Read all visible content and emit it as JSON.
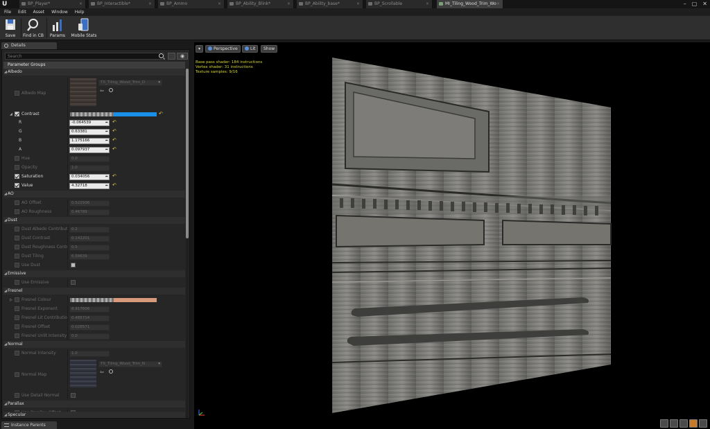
{
  "tabs": [
    {
      "label": "BP_Player*",
      "active": false
    },
    {
      "label": "BP_Interactible*",
      "active": false
    },
    {
      "label": "BP_Ammo",
      "active": false
    },
    {
      "label": "BP_Ability_Blink*",
      "active": false
    },
    {
      "label": "BP_Ability_base*",
      "active": false
    },
    {
      "label": "BP_Scrollable",
      "active": false
    },
    {
      "label": "MI_Tiling_Wood_Trim_Wo",
      "active": true
    }
  ],
  "menu": [
    "File",
    "Edit",
    "Asset",
    "Window",
    "Help"
  ],
  "toolbar": {
    "save": "Save",
    "find_in_cb": "Find in CB",
    "params": "Params",
    "mobile_stats": "Mobile Stats"
  },
  "details": {
    "tab_label": "Details",
    "search_placeholder": "Search",
    "param_groups": "Parameter Groups",
    "instance_parents": "Instance Parents"
  },
  "albedo": {
    "category": "Albedo",
    "albedo_map": {
      "label": "Albedo Map",
      "texture": "TX_Tiling_Wood_Trim_D"
    },
    "contrast": {
      "label": "Contrast",
      "bar_color": "#1a8fe8"
    },
    "r": {
      "label": "R",
      "value": "-0.064539"
    },
    "g": {
      "label": "G",
      "value": "0.63381"
    },
    "b": {
      "label": "B",
      "value": "1.175166"
    },
    "a": {
      "label": "A",
      "value": "0.097937"
    },
    "hue": {
      "label": "Hue",
      "value": "0.0"
    },
    "opacity": {
      "label": "Opacity",
      "value": "1.0"
    },
    "saturation": {
      "label": "Saturation",
      "value": "0.034056"
    },
    "value": {
      "label": "Value",
      "value": "4.32718"
    }
  },
  "ao": {
    "category": "AO",
    "ao_offset": {
      "label": "AO Offset",
      "value": "0.522936"
    },
    "ao_roughness": {
      "label": "AO Roughness",
      "value": "0.46789"
    }
  },
  "dust": {
    "category": "Dust",
    "albedo_contribution": {
      "label": "Dust Albedo Contribution",
      "value": "0.2"
    },
    "contrast": {
      "label": "Dust Contrast",
      "value": "0.142201"
    },
    "roughness_contribution": {
      "label": "Dust Roughness Contribution",
      "value": "0.5"
    },
    "tiling": {
      "label": "Dust Tiling",
      "value": "6.59639"
    },
    "use_dust": {
      "label": "Use Dust"
    }
  },
  "emissive": {
    "category": "Emissive",
    "use_emissive": {
      "label": "Use Emissive"
    }
  },
  "fresnel": {
    "category": "Fresnel",
    "colour": {
      "label": "Fresnel Colour",
      "bar_color": "#d89a7a"
    },
    "exponent": {
      "label": "Fresnel Exponent",
      "value": "8.917606"
    },
    "lit_contribution": {
      "label": "Fresnel Lit Contribution",
      "value": "0.485714"
    },
    "offset": {
      "label": "Fresnel Offset",
      "value": "0.028571"
    },
    "unlit_intensity": {
      "label": "Fresnel Unlit Intensity",
      "value": "0.0"
    }
  },
  "normal": {
    "category": "Normal",
    "intensity": {
      "label": "Normal Intensity",
      "value": "1.0"
    },
    "normal_map": {
      "label": "Normal Map",
      "texture": "TX_Tiling_Wood_Trim_N"
    },
    "use_detail_normal": {
      "label": "Use Detail Normal"
    }
  },
  "parallax": {
    "category": "Parallax",
    "use_parallax_offset": {
      "label": "Use Parallax Offset"
    }
  },
  "specular": {
    "category": "Specular"
  },
  "viewport": {
    "perspective": "Perspective",
    "lit": "Lit",
    "show": "Show",
    "stats": [
      "Base pass shader: 184 instructions",
      "Vertex shader: 31 instructions",
      "Texture samples: 9/16"
    ]
  }
}
